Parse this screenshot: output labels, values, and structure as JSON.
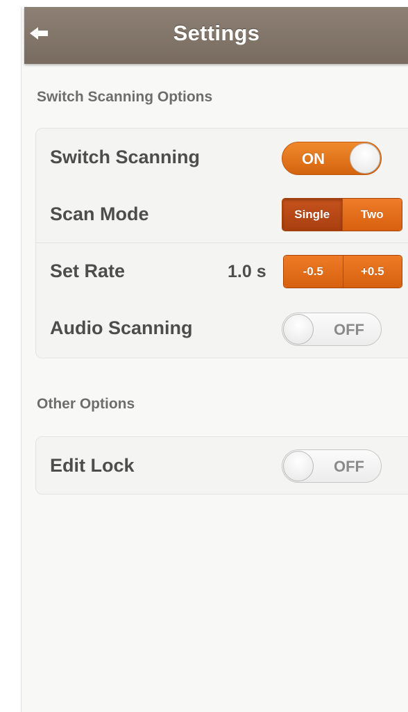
{
  "navbar": {
    "title": "Settings",
    "back_icon": "back-arrow-icon"
  },
  "sections": {
    "switch_scanning": {
      "header": "Switch Scanning Options",
      "switch_scanning": {
        "label": "Switch Scanning",
        "state": "ON"
      },
      "scan_mode": {
        "label": "Scan Mode",
        "options": [
          "Single",
          "Two"
        ],
        "selected": "Single"
      },
      "set_rate": {
        "label": "Set Rate",
        "value": "1.0 s",
        "decrease_label": "-0.5",
        "increase_label": "+0.5"
      },
      "audio_scanning": {
        "label": "Audio Scanning",
        "state": "OFF"
      }
    },
    "other": {
      "header": "Other Options",
      "edit_lock": {
        "label": "Edit Lock",
        "state": "OFF"
      }
    }
  },
  "colors": {
    "navbar": "#7f7266",
    "accent_orange": "#e5731c",
    "selected_segment": "#b84a16",
    "label_text": "#4d4d4d",
    "section_header_text": "#6d6d6d"
  }
}
